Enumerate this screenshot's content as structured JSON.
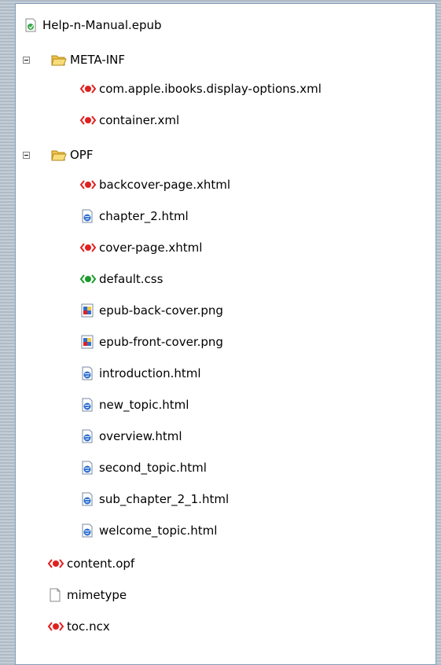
{
  "tree": {
    "root": {
      "label": "Help-n-Manual.epub",
      "icon": "epub-file-icon"
    },
    "folders": [
      {
        "label": "META-INF",
        "expanded": true,
        "files": [
          {
            "label": "com.apple.ibooks.display-options.xml",
            "icon": "xml-file-icon"
          },
          {
            "label": "container.xml",
            "icon": "xml-file-icon"
          }
        ]
      },
      {
        "label": "OPF",
        "expanded": true,
        "files": [
          {
            "label": "backcover-page.xhtml",
            "icon": "xml-file-icon"
          },
          {
            "label": "chapter_2.html",
            "icon": "html-file-icon"
          },
          {
            "label": "cover-page.xhtml",
            "icon": "xml-file-icon"
          },
          {
            "label": "default.css",
            "icon": "css-file-icon"
          },
          {
            "label": "epub-back-cover.png",
            "icon": "image-file-icon"
          },
          {
            "label": "epub-front-cover.png",
            "icon": "image-file-icon"
          },
          {
            "label": "introduction.html",
            "icon": "html-file-icon"
          },
          {
            "label": "new_topic.html",
            "icon": "html-file-icon"
          },
          {
            "label": "overview.html",
            "icon": "html-file-icon"
          },
          {
            "label": "second_topic.html",
            "icon": "html-file-icon"
          },
          {
            "label": "sub_chapter_2_1.html",
            "icon": "html-file-icon"
          },
          {
            "label": "welcome_topic.html",
            "icon": "html-file-icon"
          }
        ]
      }
    ],
    "root_files": [
      {
        "label": "content.opf",
        "icon": "xml-file-icon"
      },
      {
        "label": "mimetype",
        "icon": "blank-file-icon"
      },
      {
        "label": "toc.ncx",
        "icon": "xml-file-icon"
      }
    ]
  },
  "colors": {
    "xml_red": "#e02020",
    "css_green": "#1a9a2a",
    "html_blue": "#2d6fd0",
    "folder_yellow": "#f5c840",
    "panel_border": "#7f9db9"
  }
}
